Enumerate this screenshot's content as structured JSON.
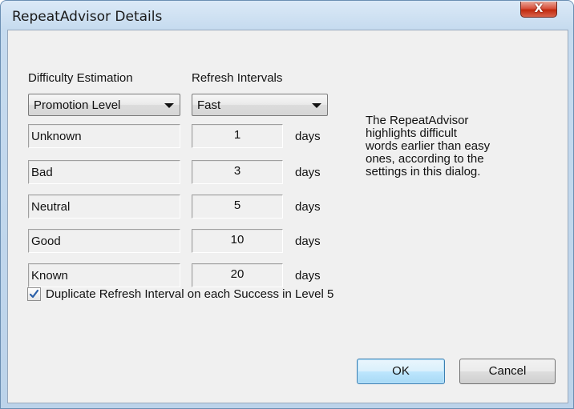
{
  "window": {
    "title": "RepeatAdvisor Details",
    "close_glyph": "X"
  },
  "headers": {
    "difficulty": "Difficulty Estimation",
    "intervals": "Refresh Intervals"
  },
  "difficulty_combo": {
    "selected": "Promotion Level"
  },
  "interval_combo": {
    "selected": "Fast"
  },
  "levels": [
    {
      "label": "Unknown",
      "days": "1",
      "unit": "days"
    },
    {
      "label": "Bad",
      "days": "3",
      "unit": "days"
    },
    {
      "label": "Neutral",
      "days": "5",
      "unit": "days"
    },
    {
      "label": "Good",
      "days": "10",
      "unit": "days"
    },
    {
      "label": "Known",
      "days": "20",
      "unit": "days"
    }
  ],
  "info_text": [
    "The RepeatAdvisor",
    "highlights difficult",
    "words earlier than easy",
    "ones, according to the",
    "settings in this dialog."
  ],
  "duplicate_option": {
    "label": "Duplicate Refresh Interval on each Success in Level 5",
    "checked": true
  },
  "buttons": {
    "ok": "OK",
    "cancel": "Cancel"
  },
  "colors": {
    "titlebar": "#c6dbef",
    "client": "#f0f0f0",
    "close_button": "#c02a0f",
    "default_button": "#bee6fd"
  },
  "icons": {
    "check": "check-icon",
    "close": "close-icon",
    "dropdown": "chevron-down-icon"
  }
}
